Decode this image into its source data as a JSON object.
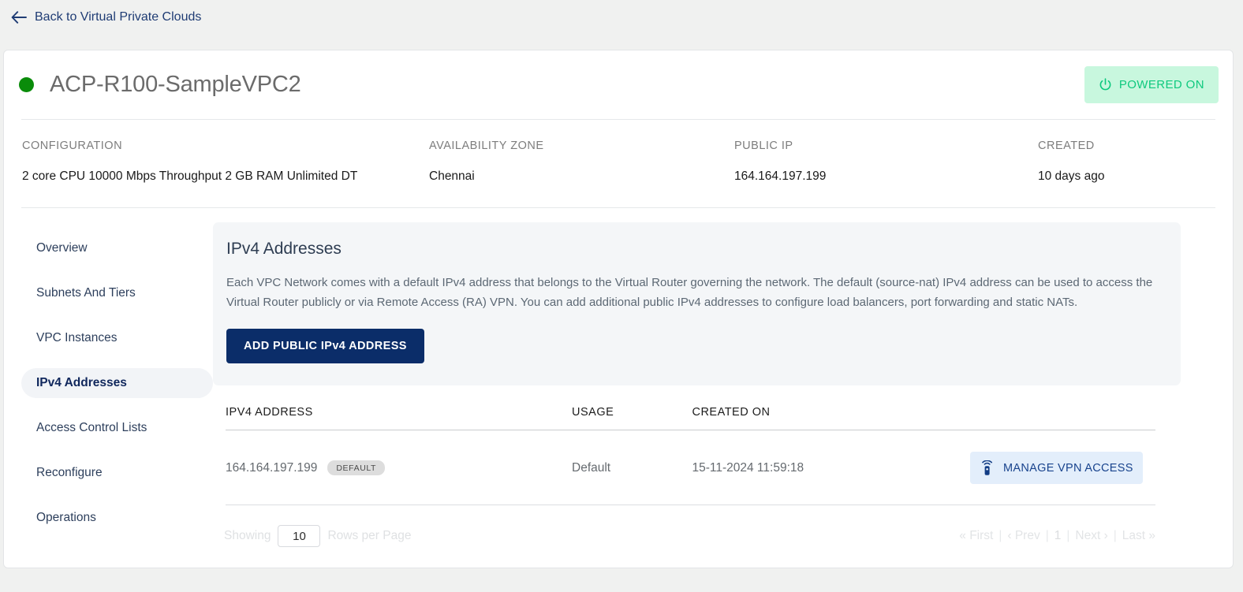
{
  "back_link": {
    "label": "Back to Virtual Private Clouds",
    "icon": "arrow-left-icon"
  },
  "header": {
    "title": "ACP-R100-SampleVPC2",
    "status_dot_color": "#0a8c0a",
    "power_badge": {
      "label": "POWERED ON",
      "icon": "power-icon",
      "bg": "#c8f7de",
      "fg": "#0ec97e"
    }
  },
  "meta": [
    {
      "label": "CONFIGURATION",
      "value": "2 core CPU 10000 Mbps Throughput 2 GB RAM Unlimited DT"
    },
    {
      "label": "AVAILABILITY ZONE",
      "value": "Chennai"
    },
    {
      "label": "PUBLIC IP",
      "value": "164.164.197.199"
    },
    {
      "label": "CREATED",
      "value": "10 days ago"
    }
  ],
  "sidebar": {
    "items": [
      {
        "label": "Overview",
        "active": false
      },
      {
        "label": "Subnets And Tiers",
        "active": false
      },
      {
        "label": "VPC Instances",
        "active": false
      },
      {
        "label": "IPv4 Addresses",
        "active": true
      },
      {
        "label": "Access Control Lists",
        "active": false
      },
      {
        "label": "Reconfigure",
        "active": false
      },
      {
        "label": "Operations",
        "active": false
      }
    ]
  },
  "panel": {
    "title": "IPv4 Addresses",
    "description": "Each VPC Network comes with a default IPv4 address that belongs to the Virtual Router governing the network. The default (source-nat) IPv4 address can be used to access the Virtual Router publicly or via Remote Access (RA) VPN. You can add additional public IPv4 addresses to configure load balancers, port forwarding and static NATs.",
    "add_button": "ADD PUBLIC IPv4 ADDRESS",
    "accent": "#0b2d69"
  },
  "table": {
    "columns": [
      "IPV4 ADDRESS",
      "USAGE",
      "CREATED ON",
      ""
    ],
    "rows": [
      {
        "ip": "164.164.197.199",
        "tag": "DEFAULT",
        "usage": "Default",
        "created_on": "15-11-2024 11:59:18",
        "action": "MANAGE VPN ACCESS",
        "action_icon": "vpn-router-icon"
      }
    ]
  },
  "pagination": {
    "showing_label": "Showing",
    "rows_per_page": "10",
    "rows_label": "Rows per Page",
    "first": "« First",
    "prev": "‹ Prev",
    "page": "1",
    "next": "Next ›",
    "last": "Last »",
    "sep": "|"
  }
}
